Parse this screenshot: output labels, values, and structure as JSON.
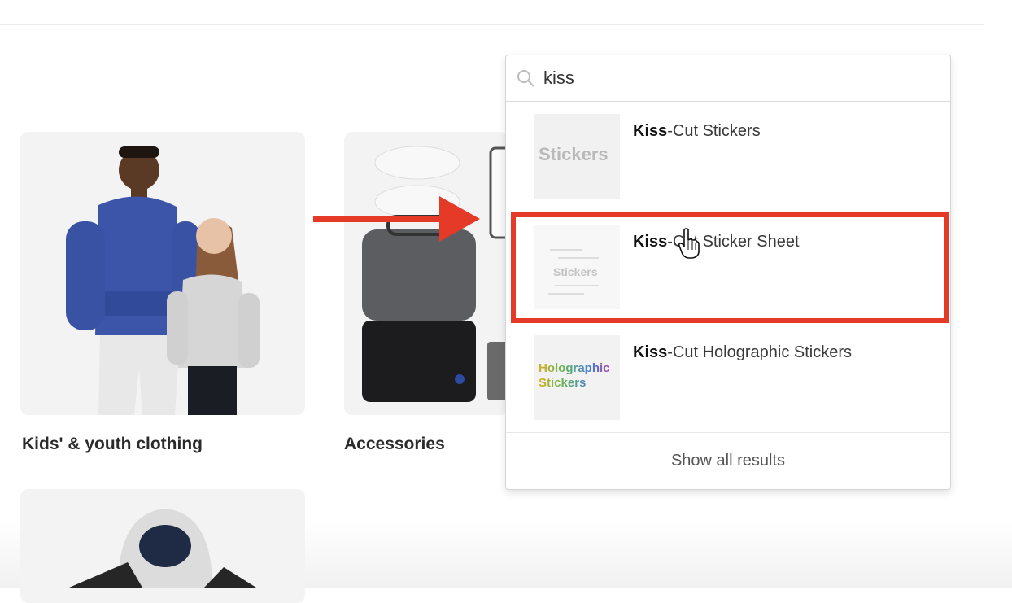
{
  "categories": [
    {
      "label": "Kids' & youth clothing"
    },
    {
      "label": "Accessories"
    }
  ],
  "search": {
    "query": "kiss",
    "results": [
      {
        "bold": "Kiss",
        "rest": "-Cut Stickers",
        "thumb_text": "Stickers"
      },
      {
        "bold": "Kiss",
        "rest": "-Cut Sticker Sheet",
        "thumb_text": "Stickers"
      },
      {
        "bold": "Kiss",
        "rest": "-Cut Holographic Stickers",
        "thumb_text": "Holographic Stickers"
      }
    ],
    "show_all_label": "Show all results"
  },
  "annotation": {
    "color": "#e53a28"
  }
}
